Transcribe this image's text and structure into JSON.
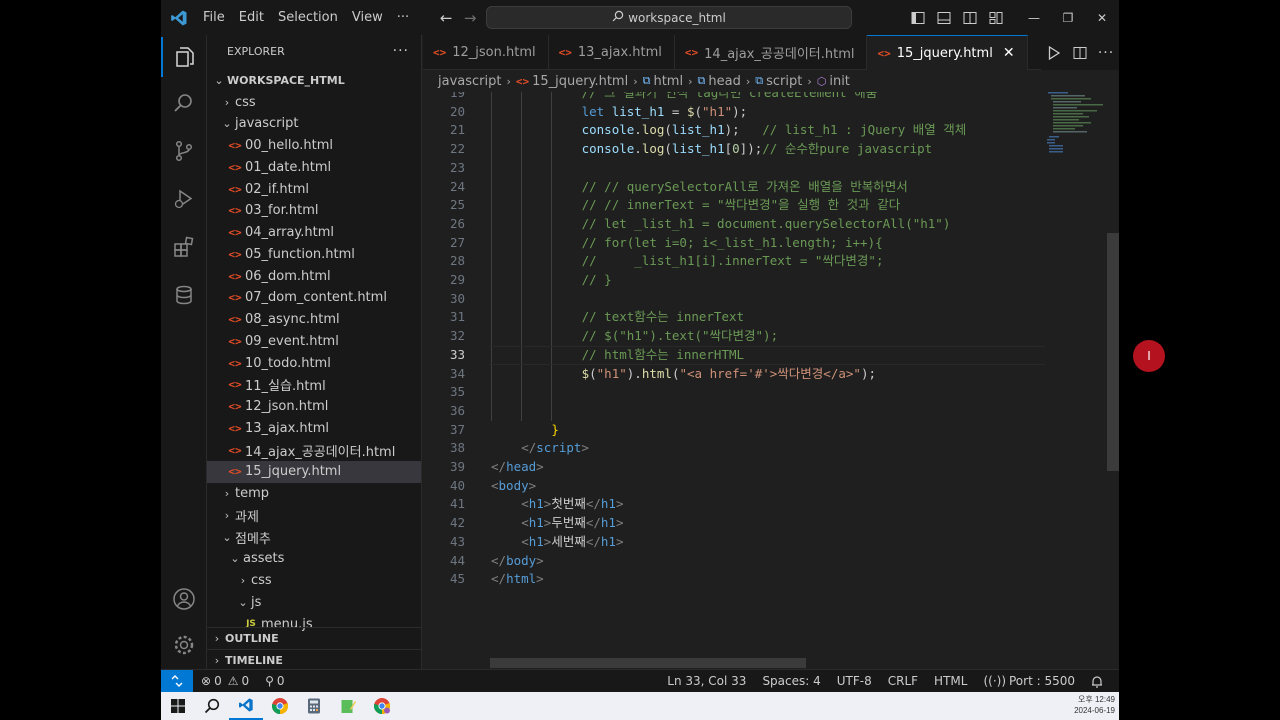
{
  "titlebar": {
    "menu": [
      "File",
      "Edit",
      "Selection",
      "View",
      "···"
    ],
    "search_text": "workspace_html"
  },
  "explorer": {
    "title": "EXPLORER",
    "more": "···",
    "root": "WORKSPACE_HTML",
    "items": [
      {
        "label": "css",
        "type": "folder",
        "open": false,
        "depth": 1
      },
      {
        "label": "javascript",
        "type": "folder",
        "open": true,
        "depth": 1
      },
      {
        "label": "00_hello.html",
        "type": "html",
        "depth": 2
      },
      {
        "label": "01_date.html",
        "type": "html",
        "depth": 2
      },
      {
        "label": "02_if.html",
        "type": "html",
        "depth": 2
      },
      {
        "label": "03_for.html",
        "type": "html",
        "depth": 2
      },
      {
        "label": "04_array.html",
        "type": "html",
        "depth": 2
      },
      {
        "label": "05_function.html",
        "type": "html",
        "depth": 2
      },
      {
        "label": "06_dom.html",
        "type": "html",
        "depth": 2
      },
      {
        "label": "07_dom_content.html",
        "type": "html",
        "depth": 2
      },
      {
        "label": "08_async.html",
        "type": "html",
        "depth": 2
      },
      {
        "label": "09_event.html",
        "type": "html",
        "depth": 2
      },
      {
        "label": "10_todo.html",
        "type": "html",
        "depth": 2
      },
      {
        "label": "11_실습.html",
        "type": "html",
        "depth": 2
      },
      {
        "label": "12_json.html",
        "type": "html",
        "depth": 2
      },
      {
        "label": "13_ajax.html",
        "type": "html",
        "depth": 2
      },
      {
        "label": "14_ajax_공공데이터.html",
        "type": "html",
        "depth": 2
      },
      {
        "label": "15_jquery.html",
        "type": "html",
        "depth": 2,
        "selected": true
      },
      {
        "label": "temp",
        "type": "folder",
        "open": false,
        "depth": 1
      },
      {
        "label": "과제",
        "type": "folder",
        "open": false,
        "depth": 1
      },
      {
        "label": "점메추",
        "type": "folder",
        "open": true,
        "depth": 1
      },
      {
        "label": "assets",
        "type": "folder",
        "open": true,
        "depth": 2
      },
      {
        "label": "css",
        "type": "folder",
        "open": false,
        "depth": 3
      },
      {
        "label": "js",
        "type": "folder",
        "open": true,
        "depth": 3
      },
      {
        "label": "menu.js",
        "type": "js",
        "depth": 4
      }
    ],
    "outline": "OUTLINE",
    "timeline": "TIMELINE"
  },
  "tabs": [
    {
      "label": "12_json.html",
      "active": false
    },
    {
      "label": "13_ajax.html",
      "active": false
    },
    {
      "label": "14_ajax_공공데이터.html",
      "active": false
    },
    {
      "label": "15_jquery.html",
      "active": true
    }
  ],
  "breadcrumb": [
    "javascript",
    "15_jquery.html",
    "html",
    "head",
    "script",
    "init"
  ],
  "editor": {
    "current_line": 33,
    "lines": [
      {
        "n": 19,
        "html": "<span class=\"c-com\">// 그 결과가 인식 tag라면 createElement 해줌</span>",
        "indent": 3
      },
      {
        "n": 20,
        "html": "<span class=\"c-kw\">let</span> <span class=\"c-var\">list_h1</span> = <span class=\"c-fn\">$</span>(<span class=\"c-str\">\"h1\"</span>);",
        "indent": 3
      },
      {
        "n": 21,
        "html": "<span class=\"c-var\">console</span>.<span class=\"c-fn\">log</span>(<span class=\"c-var\">list_h1</span>);   <span class=\"c-com\">// list_h1 : jQuery 배열 객체</span>",
        "indent": 3
      },
      {
        "n": 22,
        "html": "<span class=\"c-var\">console</span>.<span class=\"c-fn\">log</span>(<span class=\"c-var\">list_h1</span>[<span class=\"c-num\">0</span>]);<span class=\"c-com\">// 순수한pure javascript</span>",
        "indent": 3
      },
      {
        "n": 23,
        "html": "",
        "indent": 3
      },
      {
        "n": 24,
        "html": "<span class=\"c-com\">// // querySelectorAll로 가져온 배열을 반복하면서</span>",
        "indent": 3
      },
      {
        "n": 25,
        "html": "<span class=\"c-com\">// // innerText = \"싹다변경\"을 실행 한 것과 같다</span>",
        "indent": 3
      },
      {
        "n": 26,
        "html": "<span class=\"c-com\">// let _list_h1 = document.querySelectorAll(\"h1\")</span>",
        "indent": 3
      },
      {
        "n": 27,
        "html": "<span class=\"c-com\">// for(let i=0; i&lt;_list_h1.length; i++){</span>",
        "indent": 3
      },
      {
        "n": 28,
        "html": "<span class=\"c-com\">//     _list_h1[i].innerText = \"싹다변경\";</span>",
        "indent": 3
      },
      {
        "n": 29,
        "html": "<span class=\"c-com\">// }</span>",
        "indent": 3
      },
      {
        "n": 30,
        "html": "",
        "indent": 3
      },
      {
        "n": 31,
        "html": "<span class=\"c-com\">// text함수는 innerText</span>",
        "indent": 3
      },
      {
        "n": 32,
        "html": "<span class=\"c-com\">// $(\"h1\").text(\"싹다변경\");</span>",
        "indent": 3
      },
      {
        "n": 33,
        "html": "<span class=\"c-com\">// html함수는 innerHTML</span>",
        "indent": 3
      },
      {
        "n": 34,
        "html": "<span class=\"c-fn\">$</span>(<span class=\"c-str\">\"h1\"</span>).<span class=\"c-fn\">html</span>(<span class=\"c-str\">\"&lt;a href='#'&gt;싹다변경&lt;/a&gt;\"</span>);",
        "indent": 3
      },
      {
        "n": 35,
        "html": "",
        "indent": 3
      },
      {
        "n": 36,
        "html": "",
        "indent": 3
      },
      {
        "n": 37,
        "html": "<span class=\"c-y\">}</span>",
        "indent": 2
      },
      {
        "n": 38,
        "html": "<span class=\"c-brk\">&lt;/</span><span class=\"c-tag\">script</span><span class=\"c-brk\">&gt;</span>",
        "indent": 1
      },
      {
        "n": 39,
        "html": "<span class=\"c-brk\">&lt;/</span><span class=\"c-tag\">head</span><span class=\"c-brk\">&gt;</span>",
        "indent": 0
      },
      {
        "n": 40,
        "html": "<span class=\"c-brk\">&lt;</span><span class=\"c-tag\">body</span><span class=\"c-brk\">&gt;</span>",
        "indent": 0
      },
      {
        "n": 41,
        "html": "<span class=\"c-brk\">&lt;</span><span class=\"c-tag\">h1</span><span class=\"c-brk\">&gt;</span>첫번째<span class=\"c-brk\">&lt;/</span><span class=\"c-tag\">h1</span><span class=\"c-brk\">&gt;</span>",
        "indent": 1
      },
      {
        "n": 42,
        "html": "<span class=\"c-brk\">&lt;</span><span class=\"c-tag\">h1</span><span class=\"c-brk\">&gt;</span>두번째<span class=\"c-brk\">&lt;/</span><span class=\"c-tag\">h1</span><span class=\"c-brk\">&gt;</span>",
        "indent": 1
      },
      {
        "n": 43,
        "html": "<span class=\"c-brk\">&lt;</span><span class=\"c-tag\">h1</span><span class=\"c-brk\">&gt;</span>세번째<span class=\"c-brk\">&lt;/</span><span class=\"c-tag\">h1</span><span class=\"c-brk\">&gt;</span>",
        "indent": 1
      },
      {
        "n": 44,
        "html": "<span class=\"c-brk\">&lt;/</span><span class=\"c-tag\">body</span><span class=\"c-brk\">&gt;</span>",
        "indent": 0
      },
      {
        "n": 45,
        "html": "<span class=\"c-brk\">&lt;/</span><span class=\"c-tag\">html</span><span class=\"c-brk\">&gt;</span>",
        "indent": 0
      }
    ]
  },
  "statusbar": {
    "errors": "0",
    "warnings": "0",
    "ports": "0",
    "position": "Ln 33, Col 33",
    "spaces": "Spaces: 4",
    "encoding": "UTF-8",
    "eol": "CRLF",
    "language": "HTML",
    "port": "Port : 5500"
  },
  "clock": {
    "time": "오후 12:49",
    "date": "2024-06-19"
  },
  "colors": {
    "accent": "#0078d4",
    "html_icon": "#e44d26"
  }
}
